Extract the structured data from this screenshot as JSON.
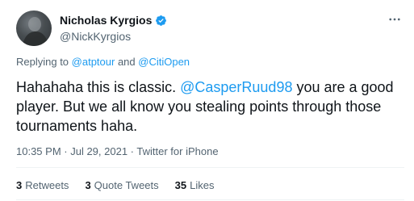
{
  "user": {
    "display_name": "Nicholas Kyrgios",
    "handle": "@NickKyrgios"
  },
  "reply": {
    "prefix": "Replying to ",
    "mention1": "@atptour",
    "joiner": " and ",
    "mention2": "@CitiOpen"
  },
  "tweet": {
    "text_before": "Hahahaha this is classic. ",
    "mention": "@CasperRuud98",
    "text_after": " you are a good player. But we all know you stealing points through those tournaments haha."
  },
  "meta": {
    "time": "10:35 PM",
    "sep1": " · ",
    "date": "Jul 29, 2021",
    "sep2": " · ",
    "source": "Twitter for iPhone"
  },
  "stats": {
    "retweets_count": "3",
    "retweets_label": "Retweets",
    "quotes_count": "3",
    "quotes_label": "Quote Tweets",
    "likes_count": "35",
    "likes_label": "Likes"
  },
  "colors": {
    "link": "#1d9bf0",
    "secondary_text": "#536471",
    "primary_text": "#0f1419"
  }
}
